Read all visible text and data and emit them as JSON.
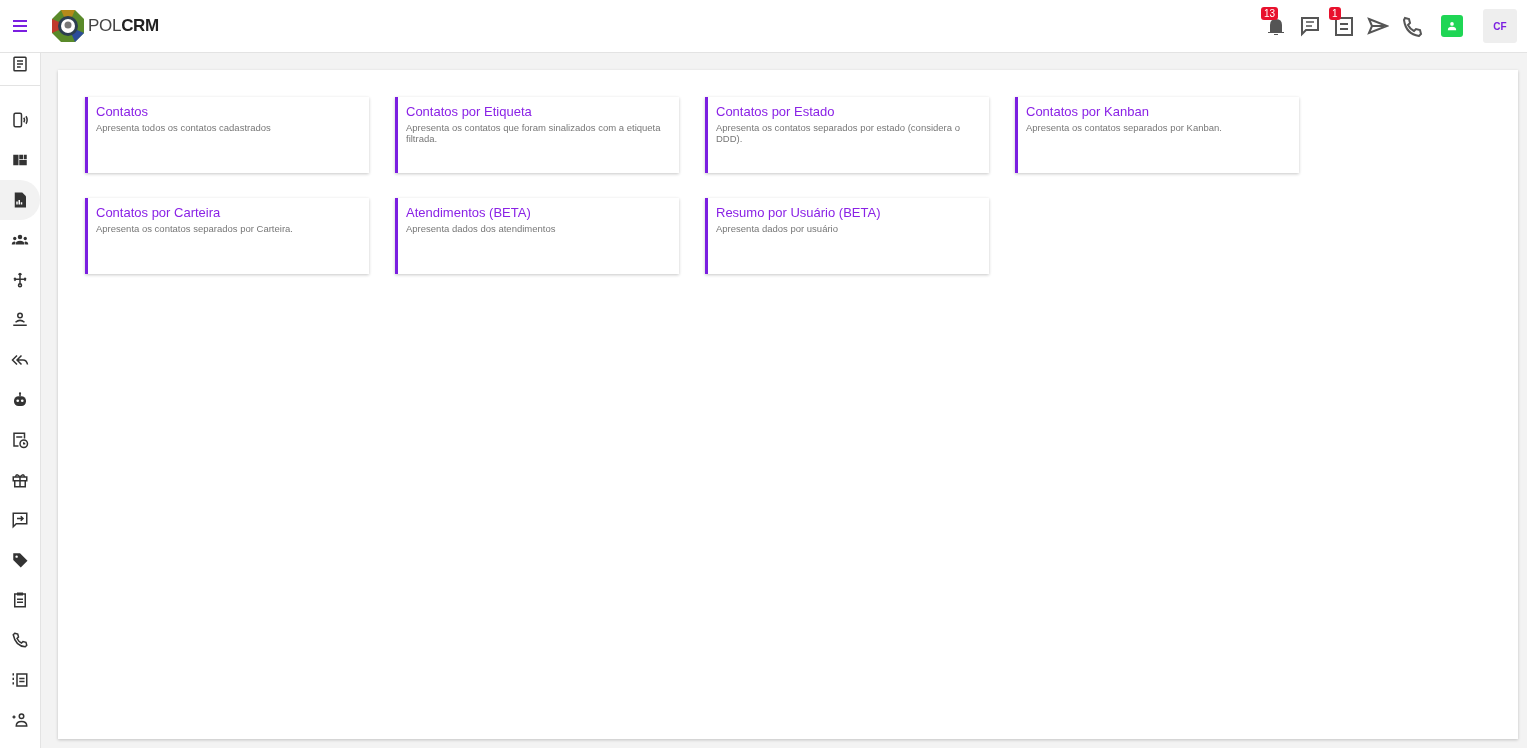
{
  "header": {
    "logo_text": "POL**CRM**",
    "notifications_badge": "13",
    "tasks_badge": "1",
    "avatar": "CF"
  },
  "sidebar": {
    "items": [
      {
        "selected": false
      },
      {
        "selected": false
      },
      {
        "selected": false
      },
      {
        "selected": true
      },
      {
        "selected": false
      },
      {
        "selected": false
      },
      {
        "selected": false
      },
      {
        "selected": false
      },
      {
        "selected": false
      },
      {
        "selected": false
      },
      {
        "selected": false
      },
      {
        "selected": false
      },
      {
        "selected": false
      },
      {
        "selected": false
      },
      {
        "selected": false
      },
      {
        "selected": false
      },
      {
        "selected": false
      }
    ]
  },
  "reports": [
    {
      "title": "Contatos",
      "description": "Apresenta todos os contatos cadastrados"
    },
    {
      "title": "Contatos por Etiqueta",
      "description": "Apresenta os contatos que foram sinalizados com a etiqueta filtrada."
    },
    {
      "title": "Contatos por Estado",
      "description": "Apresenta os contatos separados por estado (considera o DDD)."
    },
    {
      "title": "Contatos por Kanban",
      "description": "Apresenta os contatos separados por Kanban."
    },
    {
      "title": "Contatos por Carteira",
      "description": "Apresenta os contatos separados por Carteira."
    },
    {
      "title": "Atendimentos (BETA)",
      "description": "Apresenta dados dos atendimentos"
    },
    {
      "title": "Resumo por Usuário (BETA)",
      "description": "Apresenta dados por usuário"
    }
  ]
}
